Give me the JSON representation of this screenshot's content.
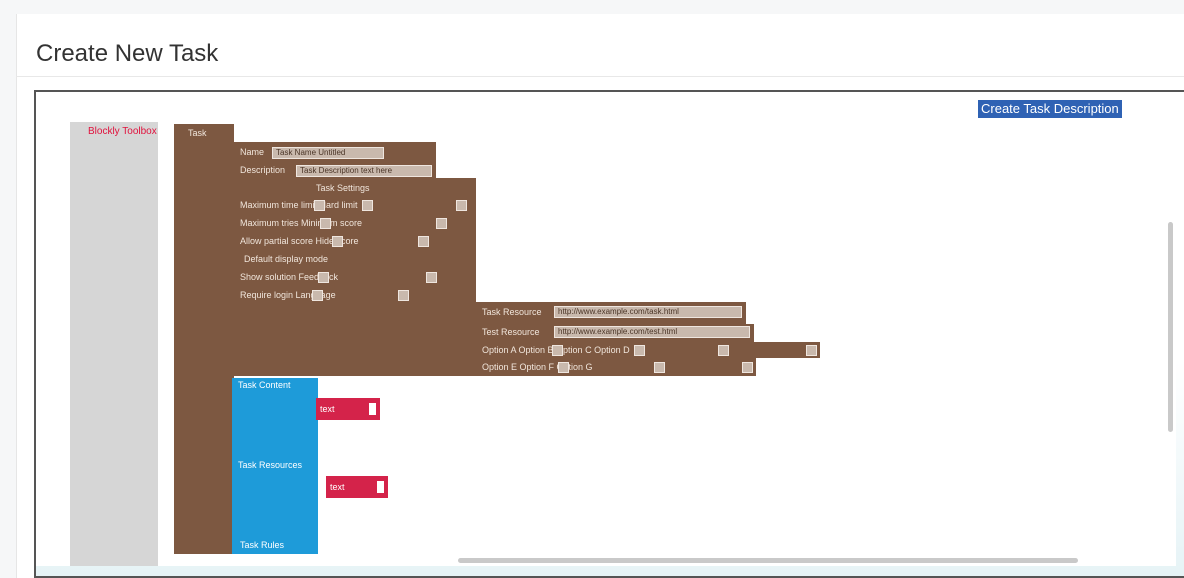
{
  "page": {
    "title": "Create New Task"
  },
  "describe_button": {
    "label": "Create Task Description"
  },
  "toolbox": {
    "label": "Blockly Toolbox"
  },
  "task_block": {
    "header": "Task",
    "name_label": "Name",
    "name_value": "Task Name Untitled",
    "description_label": "Description",
    "description_value": "Task Description text here",
    "settings_header": "Task Settings",
    "settings_rows": [
      "Maximum time limit  Hard limit",
      "Maximum tries  Minimum score",
      "Allow partial score  Hide score",
      "Default display mode",
      "Show solution  Feedback",
      "Require login  Language"
    ],
    "resource_rows": [
      {
        "label": "Task Resource",
        "value": "http://www.example.com/task.html"
      },
      {
        "label": "Test Resource",
        "value": "http://www.example.com/test.html"
      }
    ],
    "option_rows": [
      "Option A  Option B  Option C  Option D",
      "Option E  Option F  Option G"
    ]
  },
  "blue_blocks": [
    {
      "label": "Task Content",
      "red_label": "text"
    },
    {
      "label": "Task Resources",
      "red_label": "text"
    },
    {
      "label": "Task Rules"
    }
  ],
  "colors": {
    "block_brown": "#7d5841",
    "block_blue": "#1e9bd9",
    "block_red": "#d4234a",
    "selection_blue": "#2f62b4"
  }
}
